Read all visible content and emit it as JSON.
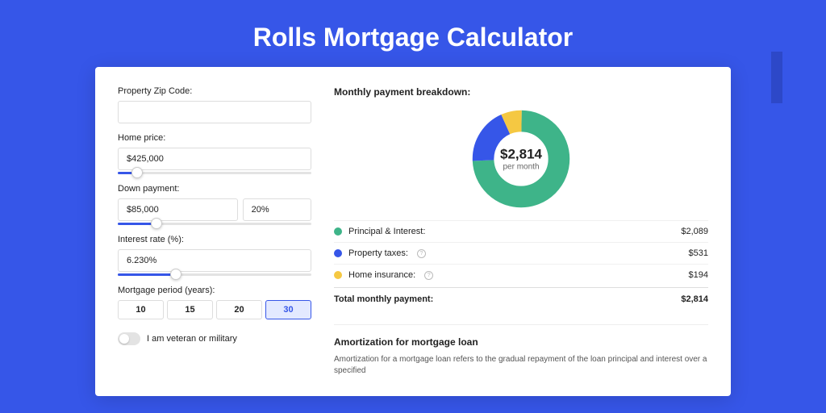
{
  "title": "Rolls Mortgage Calculator",
  "left": {
    "zip_label": "Property Zip Code:",
    "zip_value": "",
    "home_price_label": "Home price:",
    "home_price_value": "$425,000",
    "home_price_slider_pct": 10,
    "down_payment_label": "Down payment:",
    "down_payment_value": "$85,000",
    "down_payment_pct": "20%",
    "down_payment_slider_pct": 20,
    "interest_label": "Interest rate (%):",
    "interest_value": "6.230%",
    "interest_slider_pct": 30,
    "period_label": "Mortgage period (years):",
    "periods": [
      "10",
      "15",
      "20",
      "30"
    ],
    "period_active": 3,
    "veteran_label": "I am veteran or military"
  },
  "right": {
    "breakdown_title": "Monthly payment breakdown:",
    "center_amount": "$2,814",
    "center_sub": "per month",
    "rows": [
      {
        "color": "green",
        "label": "Principal & Interest:",
        "info": false,
        "value": "$2,089"
      },
      {
        "color": "blue",
        "label": "Property taxes:",
        "info": true,
        "value": "$531"
      },
      {
        "color": "yellow",
        "label": "Home insurance:",
        "info": true,
        "value": "$194"
      }
    ],
    "total_label": "Total monthly payment:",
    "total_value": "$2,814",
    "amort_title": "Amortization for mortgage loan",
    "amort_text": "Amortization for a mortgage loan refers to the gradual repayment of the loan principal and interest over a specified"
  },
  "chart_data": {
    "type": "pie",
    "title": "Monthly payment breakdown",
    "series": [
      {
        "name": "Principal & Interest",
        "value": 2089,
        "color": "#3eb489"
      },
      {
        "name": "Property taxes",
        "value": 531,
        "color": "#3656e8"
      },
      {
        "name": "Home insurance",
        "value": 194,
        "color": "#f5c842"
      }
    ],
    "total": 2814
  }
}
